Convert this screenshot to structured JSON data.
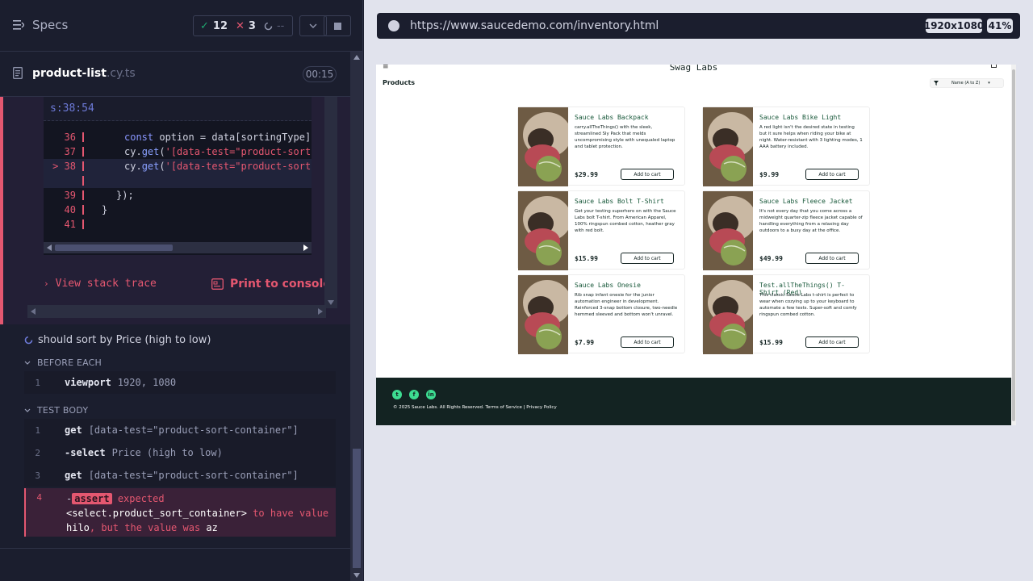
{
  "reporter": {
    "specs_label": "Specs",
    "stats": {
      "passed": "12",
      "failed": "3",
      "pending": "--"
    },
    "spec": {
      "name": "product-list",
      "ext": ".cy.ts",
      "duration": "00:15"
    },
    "error": {
      "code_header": "s:38:54",
      "code_lines": [
        {
          "num": "36",
          "text": "const option = data[sortingType]"
        },
        {
          "num": "37",
          "text": "cy.get('[data-test=\"product-sort"
        },
        {
          "num": "> 38",
          "text": "cy.get('[data-test=\"product-sort"
        },
        {
          "num": "",
          "text": ""
        },
        {
          "num": "39",
          "text": "});"
        },
        {
          "num": "40",
          "text": "}"
        },
        {
          "num": "41",
          "text": ""
        }
      ],
      "view_stack_trace": "View stack trace",
      "print_to_console": "Print to console"
    },
    "test": {
      "title": "should sort by Price (high to low)",
      "before_each_label": "BEFORE EACH",
      "test_body_label": "TEST BODY",
      "before_each": [
        {
          "num": "1",
          "name": "viewport",
          "message": "1920, 1080"
        }
      ],
      "body": [
        {
          "num": "1",
          "name": "get",
          "message": "[data-test=\"product-sort-container\"]"
        },
        {
          "num": "2",
          "name": "-select",
          "message": "Price (high to low)"
        },
        {
          "num": "3",
          "name": "get",
          "message": "[data-test=\"product-sort-container\"]"
        }
      ],
      "failed_command": {
        "num": "4",
        "badge": "assert",
        "line1": "expected",
        "element": "<select.product_sort_container>",
        "line2": "to have value",
        "value": "hilo",
        "line3": ", but the value was",
        "actual": "az"
      }
    }
  },
  "aut": {
    "url": "https://www.saucedemo.com/inventory.html",
    "viewport": "1920x1080",
    "zoom": "41%",
    "app": {
      "logo": "Swag Labs",
      "products_title": "Products",
      "sort_value": "Name (A to Z)",
      "add_to_cart": "Add to cart",
      "items": [
        {
          "name": "Sauce Labs Backpack",
          "desc": "carry.allTheThings() with the sleek, streamlined Sly Pack that melds uncompromising style with unequaled laptop and tablet protection.",
          "price": "$29.99"
        },
        {
          "name": "Sauce Labs Bike Light",
          "desc": "A red light isn't the desired state in testing but it sure helps when riding your bike at night. Water-resistant with 3 lighting modes, 1 AAA battery included.",
          "price": "$9.99"
        },
        {
          "name": "Sauce Labs Bolt T-Shirt",
          "desc": "Get your testing superhero on with the Sauce Labs bolt T-shirt. From American Apparel, 100% ringspun combed cotton, heather gray with red bolt.",
          "price": "$15.99"
        },
        {
          "name": "Sauce Labs Fleece Jacket",
          "desc": "It's not every day that you come across a midweight quarter-zip fleece jacket capable of handling everything from a relaxing day outdoors to a busy day at the office.",
          "price": "$49.99"
        },
        {
          "name": "Sauce Labs Onesie",
          "desc": "Rib snap infant onesie for the junior automation engineer in development. Reinforced 3-snap bottom closure, two-needle hemmed sleeved and bottom won't unravel.",
          "price": "$7.99"
        },
        {
          "name": "Test.allTheThings() T-Shirt (Red)",
          "desc": "This classic Sauce Labs t-shirt is perfect to wear when cozying up to your keyboard to automate a few tests. Super-soft and comfy ringspun combed cotton.",
          "price": "$15.99"
        }
      ],
      "footer_copyright": "© 2025 Sauce Labs. All Rights Reserved. Terms of Service | Privacy Policy"
    }
  }
}
